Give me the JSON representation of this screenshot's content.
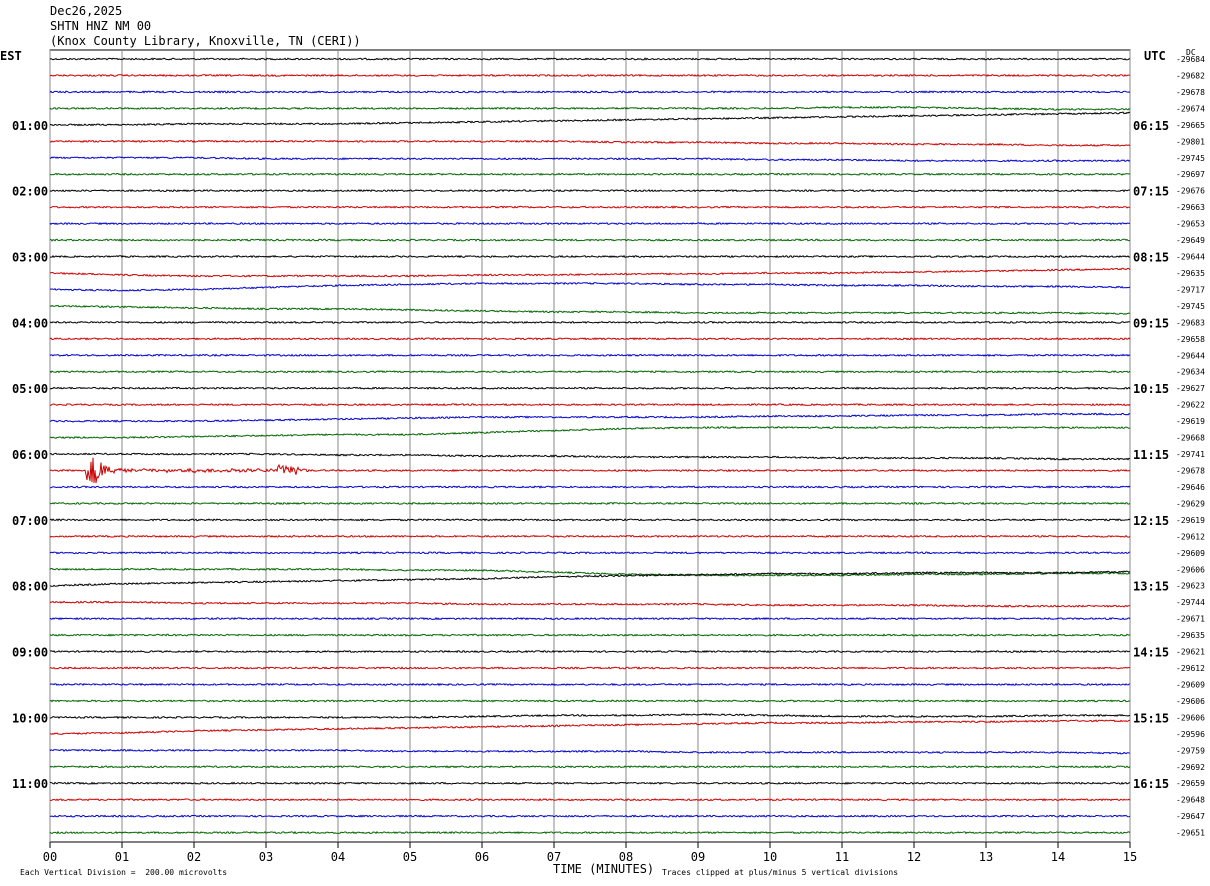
{
  "header": {
    "date": "Dec26,2025",
    "station": "SHTN HNZ NM 00",
    "location": "(Knox County Library, Knoxville, TN (CERI))"
  },
  "left_zone_label": "EST",
  "right_zone_label": "UTC",
  "dc_label": "DC",
  "xlabel": "TIME (MINUTES)",
  "footer_left": "Each Vertical Division =  200.00 microvolts",
  "footer_right": "Traces clipped at plus/minus 5 vertical divisions",
  "colors": {
    "trace_cycle": [
      "#000000",
      "#cc0000",
      "#0000cc",
      "#006600"
    ],
    "grid": "#888888"
  },
  "chart_data": {
    "type": "line",
    "title": "",
    "xlim": [
      0,
      15
    ],
    "x_ticks": [
      "00",
      "01",
      "02",
      "03",
      "04",
      "05",
      "06",
      "07",
      "08",
      "09",
      "10",
      "11",
      "12",
      "13",
      "14",
      "15"
    ],
    "left_hour_labels": [
      "01:00",
      "02:00",
      "03:00",
      "04:00",
      "05:00",
      "06:00",
      "07:00",
      "08:00",
      "09:00",
      "10:00",
      "11:00"
    ],
    "right_hour_labels": [
      "06:15",
      "07:15",
      "08:15",
      "09:15",
      "10:15",
      "11:15",
      "12:15",
      "13:15",
      "14:15",
      "15:15",
      "16:15"
    ],
    "row_dc_values": [
      "-29684",
      "-29682",
      "-29678",
      "-29674",
      "-29665",
      "-29801",
      "-29745",
      "-29697",
      "-29676",
      "-29663",
      "-29653",
      "-29649",
      "-29644",
      "-29635",
      "-29717",
      "-29745",
      "-29683",
      "-29658",
      "-29644",
      "-29634",
      "-29627",
      "-29622",
      "-29619",
      "-29668",
      "-29741",
      "-29678",
      "-29646",
      "-29629",
      "-29619",
      "-29612",
      "-29609",
      "-29606",
      "-29623",
      "-29744",
      "-29671",
      "-29635",
      "-29621",
      "-29612",
      "-29609",
      "-29606",
      "-29606",
      "-29596",
      "-29759",
      "-29692",
      "-29659",
      "-29648",
      "-29647",
      "-29651"
    ],
    "event": {
      "row": 25,
      "start_min": 0.5,
      "peak_min": 0.6,
      "end_min": 1.0,
      "secondary_min": 3.3
    }
  }
}
